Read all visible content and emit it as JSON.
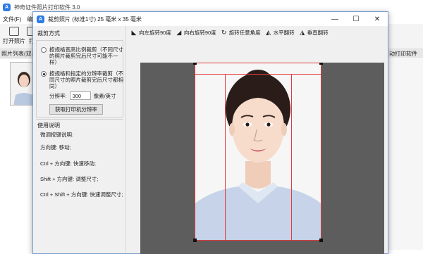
{
  "main_window": {
    "title": "神奇证件照片打印软件 3.0",
    "logo_glyph": "A",
    "menu": [
      "文件(F)",
      "编"
    ],
    "toolbar": [
      {
        "label": "打开照片"
      },
      {
        "label": "打"
      }
    ],
    "list_header": "照片列表(双击",
    "auto_print_label": "自动打印软件"
  },
  "dialog": {
    "title": "裁剪照片 (标准1寸) 25 毫米 x 35 毫米",
    "logo_glyph": "A",
    "crop_mode": {
      "title": "裁剪方式",
      "options": [
        {
          "label": "按规格宽高比例裁剪（不同尺寸的照片裁剪完后尺寸可能不一样）",
          "selected": false
        },
        {
          "label": "按规格和指定的分辨率裁剪（不同尺寸的照片裁剪完后尺寸都相同）",
          "selected": true
        }
      ],
      "dpi_label": "分辨率:",
      "dpi_value": "300",
      "dpi_unit": "像素/英寸",
      "get_dpi_button": "获取打印机分辨率"
    },
    "help": {
      "title": "使用说明",
      "lines": [
        "微调按键说明:",
        "方向键: 移动;",
        "Ctrl + 方向键: 快速移动;",
        "Shift + 方向键: 调整尺寸;",
        "Ctrl + Shift + 方向键: 快速调整尺寸;"
      ]
    },
    "toolbar": [
      {
        "icon": "rotate-left-icon",
        "label": "向左旋转90度"
      },
      {
        "icon": "rotate-right-icon",
        "label": "向右旋转90度"
      },
      {
        "icon": "rotate-any-icon",
        "label": "旋转任意角度"
      },
      {
        "icon": "flip-horizontal-icon",
        "label": "水平翻转"
      },
      {
        "icon": "flip-vertical-icon",
        "label": "垂直翻转"
      }
    ]
  },
  "colors": {
    "crop_frame": "#e23a3a",
    "canvas_bg": "#5d5d5d",
    "accent": "#2d7be5"
  }
}
